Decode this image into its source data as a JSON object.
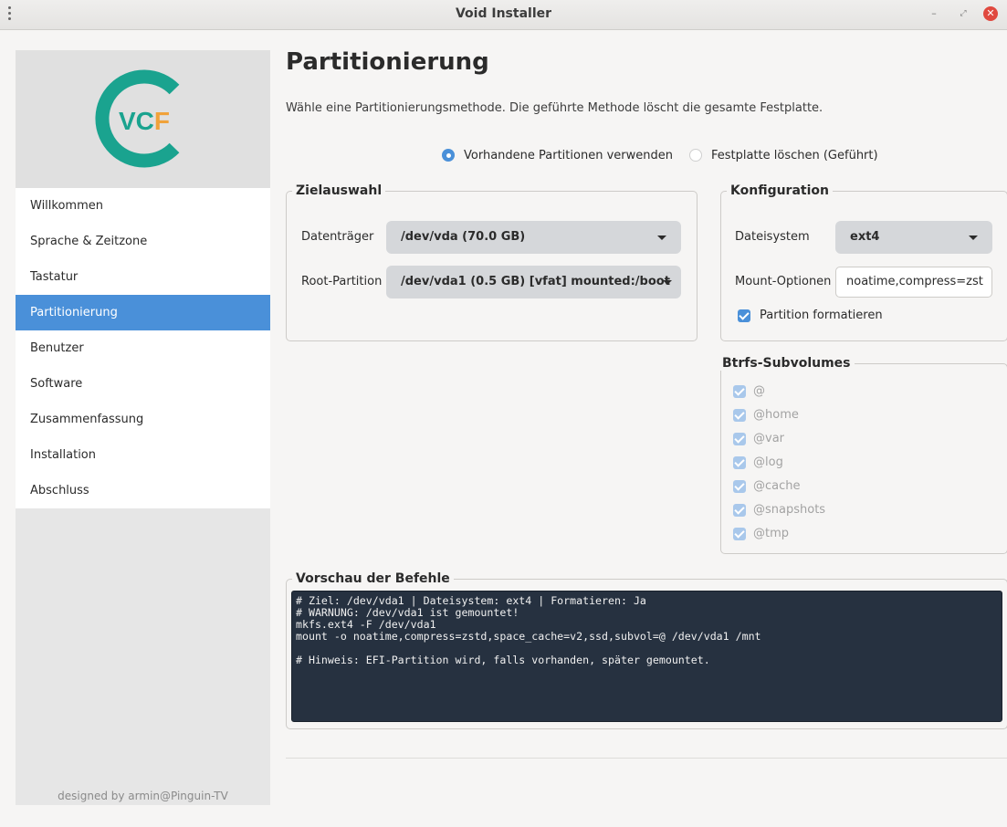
{
  "window": {
    "title": "Void Installer",
    "controls": {
      "minimize": "–",
      "maximize": "⤢",
      "close": "✕"
    }
  },
  "logo": {
    "text": "VCF",
    "colors": {
      "ring": "#1aa38f",
      "v": "#1aa38f",
      "c": "#1aa38f",
      "f": "#f0a23a"
    }
  },
  "sidebar": {
    "items": [
      {
        "label": "Willkommen",
        "active": false
      },
      {
        "label": "Sprache & Zeitzone",
        "active": false
      },
      {
        "label": "Tastatur",
        "active": false
      },
      {
        "label": "Partitionierung",
        "active": true
      },
      {
        "label": "Benutzer",
        "active": false
      },
      {
        "label": "Software",
        "active": false
      },
      {
        "label": "Zusammenfassung",
        "active": false
      },
      {
        "label": "Installation",
        "active": false
      },
      {
        "label": "Abschluss",
        "active": false
      }
    ],
    "credit": "designed by armin@Pinguin-TV"
  },
  "main": {
    "title": "Partitionierung",
    "subtitle": "Wähle eine Partitionierungsmethode. Die geführte Methode löscht die gesamte Festplatte.",
    "method": {
      "options": [
        {
          "label": "Vorhandene Partitionen verwenden",
          "selected": true
        },
        {
          "label": "Festplatte löschen (Geführt)",
          "selected": false
        }
      ]
    },
    "target": {
      "title": "Zielauswahl",
      "disk_label": "Datenträger",
      "disk_value": "/dev/vda (70.0 GB)",
      "root_label": "Root-Partition",
      "root_value": "/dev/vda1 (0.5 GB) [vfat] mounted:/boot"
    },
    "config": {
      "title": "Konfiguration",
      "fs_label": "Dateisystem",
      "fs_value": "ext4",
      "mount_label": "Mount-Optionen",
      "mount_value": "noatime,compress=zst",
      "format_label": "Partition formatieren",
      "format_checked": true
    },
    "subvolumes": {
      "title": "Btrfs-Subvolumes",
      "items": [
        "@",
        "@home",
        "@var",
        "@log",
        "@cache",
        "@snapshots",
        "@tmp"
      ]
    },
    "preview": {
      "title": "Vorschau der Befehle",
      "lines": [
        "# Ziel: /dev/vda1 | Dateisystem: ext4 | Formatieren: Ja",
        "# WARNUNG: /dev/vda1 ist gemountet!",
        "mkfs.ext4 -F /dev/vda1",
        "mount -o noatime,compress=zstd,space_cache=v2,ssd,subvol=@ /dev/vda1 /mnt",
        "",
        "# Hinweis: EFI-Partition wird, falls vorhanden, später gemountet."
      ]
    }
  },
  "colors": {
    "accent": "#4a90d9",
    "terminal_bg": "#263140",
    "close_button": "#e0493f"
  }
}
